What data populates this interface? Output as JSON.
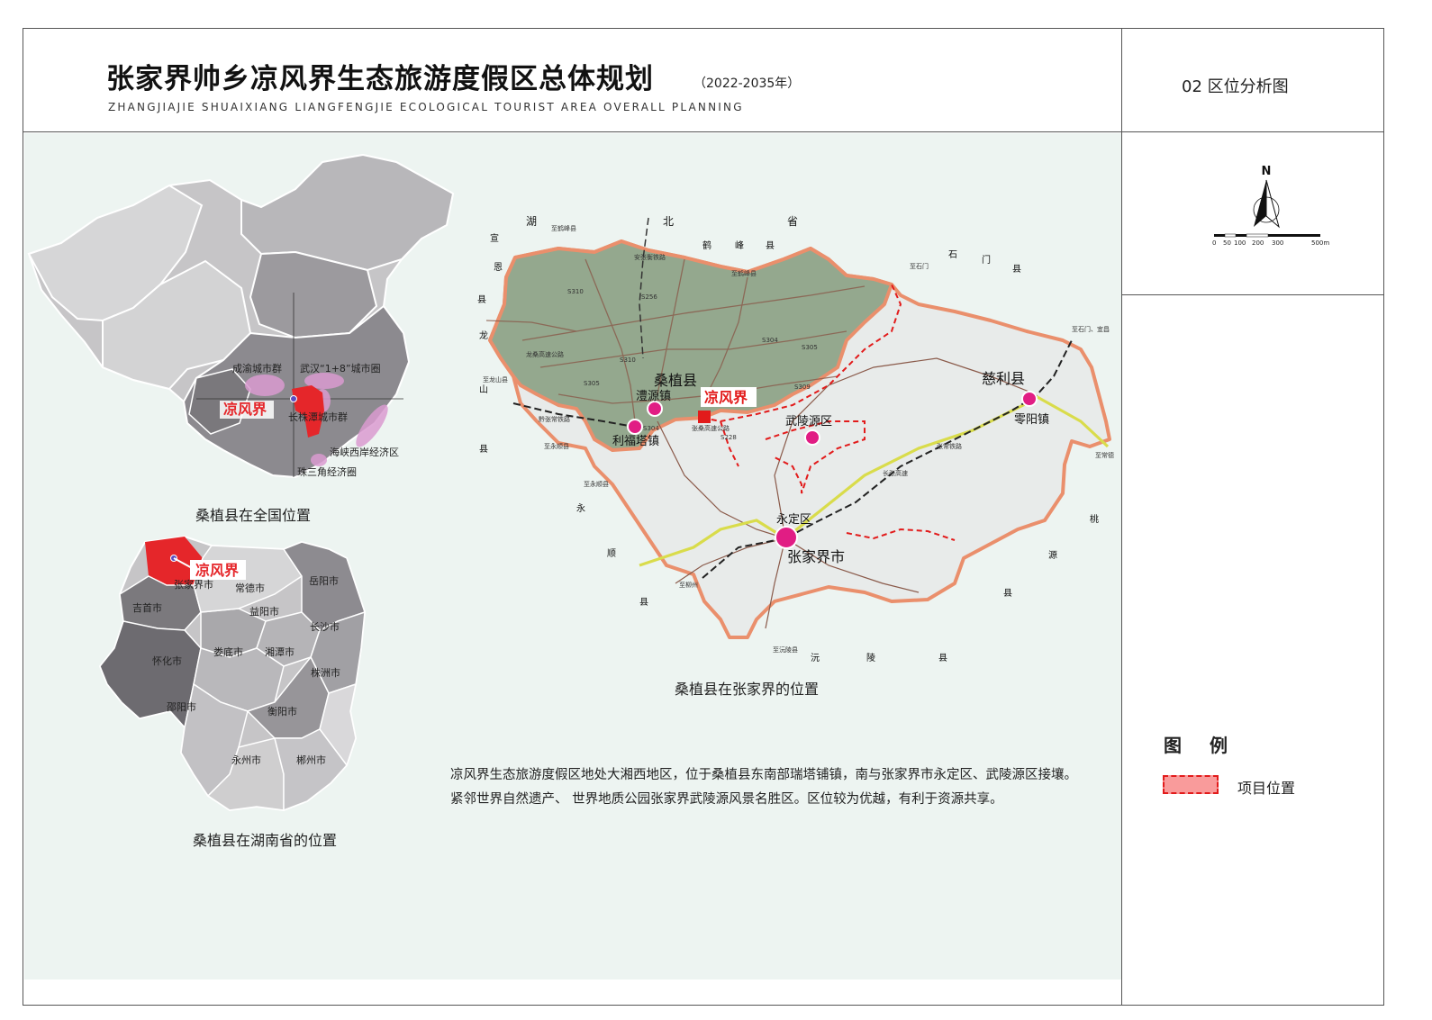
{
  "header": {
    "title": "张家界帅乡凉风界生态旅游度假区总体规划",
    "year": "（2022-2035年）",
    "subtitle_en": "ZHANGJIAJIE SHUAIXIANG LIANGFENGJIE ECOLOGICAL TOURIST AREA OVERALL PLANNING",
    "sheet": "02 区位分析图"
  },
  "compass": {
    "north": "N",
    "scale_labels": [
      "0",
      "50",
      "100",
      "200",
      "300",
      "500m"
    ]
  },
  "legend": {
    "title": "图 例",
    "items": [
      {
        "label": "项目位置",
        "color": "#f99b9b",
        "border": "#e21b1b"
      }
    ]
  },
  "china_map": {
    "caption": "桑植县在全国位置",
    "project": "凉风界",
    "clusters": [
      "成渝城市群",
      "武汉“1+8”城市圈",
      "长株潭城市群",
      "海峡西岸经济区",
      "珠三角经济圈"
    ]
  },
  "hunan_map": {
    "caption": "桑植县在湖南省的位置",
    "project": "凉风界",
    "cities": [
      "张家界市",
      "常德市",
      "岳阳市",
      "吉首市",
      "益阳市",
      "长沙市",
      "娄底市",
      "湘潭市",
      "怀化市",
      "株洲市",
      "邵阳市",
      "衡阳市",
      "永州市",
      "郴州市"
    ]
  },
  "zjj_map": {
    "caption": "桑植县在张家界的位置",
    "project": "凉风界",
    "county": "桑植县",
    "towns": [
      "澧源镇",
      "利福塔镇",
      "武陵源区",
      "慈利县",
      "零阳镇",
      "永定区",
      "张家界市"
    ],
    "neighbors": {
      "hubei": [
        "湖",
        "北",
        "省"
      ],
      "hefeng": [
        "鹤",
        "峰",
        "县"
      ],
      "shimen": [
        "石",
        "门",
        "县"
      ],
      "xuanen": [
        "宣",
        "恩",
        "县"
      ],
      "longshan": [
        "龙",
        "山",
        "县"
      ],
      "yongshun": [
        "永",
        "顺",
        "县"
      ],
      "yuanling": [
        "沅",
        "陵",
        "县"
      ],
      "taoyuan": [
        "桃",
        "源",
        "县"
      ]
    },
    "destinations": [
      "至鹤峰县",
      "至鹤峰县",
      "至石门",
      "至石门、宜昌",
      "至龙山县",
      "至永顺县",
      "至永顺县",
      "至常德",
      "至沅陵县",
      "至柳州"
    ],
    "roads": [
      "S310",
      "S256",
      "S305",
      "S304",
      "S309",
      "S228",
      "S305",
      "S304",
      "S310"
    ],
    "road_names": [
      "龙桑高速公路",
      "黔张常铁路",
      "张桑高速公路",
      "长张高速",
      "张常铁路",
      "安张衡铁路"
    ]
  },
  "description": "凉风界生态旅游度假区地处大湘西地区，位于桑植县东南部瑞塔铺镇，南与张家界市永定区、武陵源区接壤。紧邻世界自然遗产、 世界地质公园张家界武陵源风景名胜区。区位较为优越，有利于资源共享。"
}
